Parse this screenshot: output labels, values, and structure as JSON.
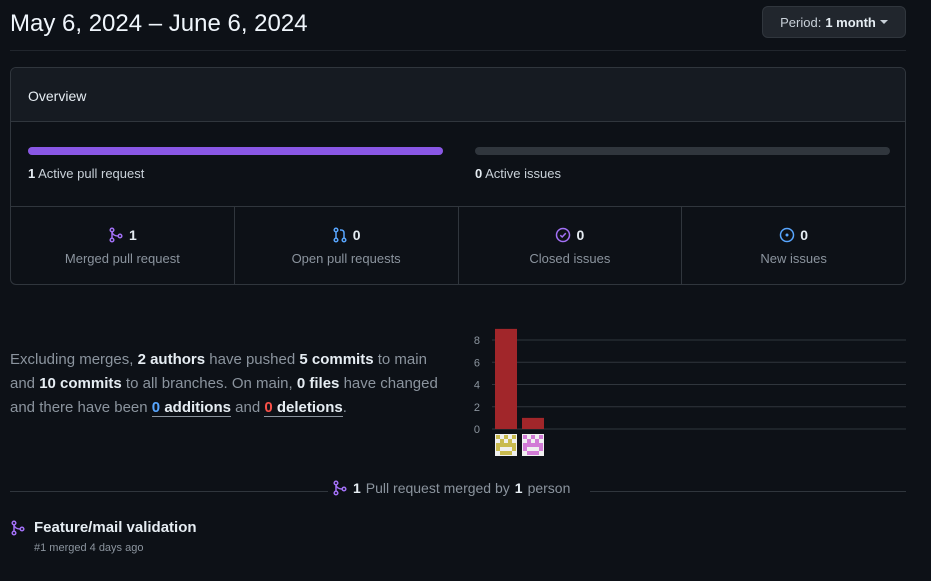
{
  "header": {
    "date_range": "May 6, 2024 – June 6, 2024",
    "period_label": "Period:",
    "period_value": "1 month"
  },
  "overview": {
    "title": "Overview",
    "pull_requests_bar": {
      "count": "1",
      "label": "Active pull request",
      "fill_fraction": 1.0,
      "color": "#8957e5"
    },
    "issues_bar": {
      "count": "0",
      "label": "Active issues",
      "fill_fraction": 0.0
    },
    "stats": [
      {
        "value": "1",
        "label": "Merged pull request",
        "icon": "git-merge-icon",
        "color": "#a371f7"
      },
      {
        "value": "0",
        "label": "Open pull requests",
        "icon": "git-pull-request-icon",
        "color": "#58a6ff"
      },
      {
        "value": "0",
        "label": "Closed issues",
        "icon": "issue-closed-icon",
        "color": "#a371f7"
      },
      {
        "value": "0",
        "label": "New issues",
        "icon": "issue-opened-icon",
        "color": "#58a6ff"
      }
    ]
  },
  "summary": {
    "p1": "Excluding merges,",
    "authors": "2 authors",
    "p2": "have pushed",
    "commits_main": "5 commits",
    "p3": "to main and",
    "commits_all": "10 commits",
    "p4": "to all branches. On main,",
    "files": "0 files",
    "p5": "have changed and there have been",
    "additions_num": "0",
    "additions_word": "additions",
    "p6": "and",
    "deletions_num": "0",
    "deletions_word": "deletions",
    "p7": "."
  },
  "chart_data": {
    "type": "bar",
    "categories": [
      "author-1",
      "author-2"
    ],
    "values": [
      9,
      1
    ],
    "yticks": [
      "0",
      "2",
      "4",
      "6",
      "8"
    ],
    "ylim": [
      0,
      9
    ],
    "bar_color": "#a1262a",
    "grid": true,
    "avatar_colors": [
      "#c9bb4f",
      "#d27bd6"
    ]
  },
  "merged": {
    "count": "1",
    "text1": "Pull request merged by",
    "people": "1",
    "text2": "person"
  },
  "pr_list": [
    {
      "title": "Feature/mail validation",
      "meta": "#1 merged 4 days ago"
    }
  ]
}
